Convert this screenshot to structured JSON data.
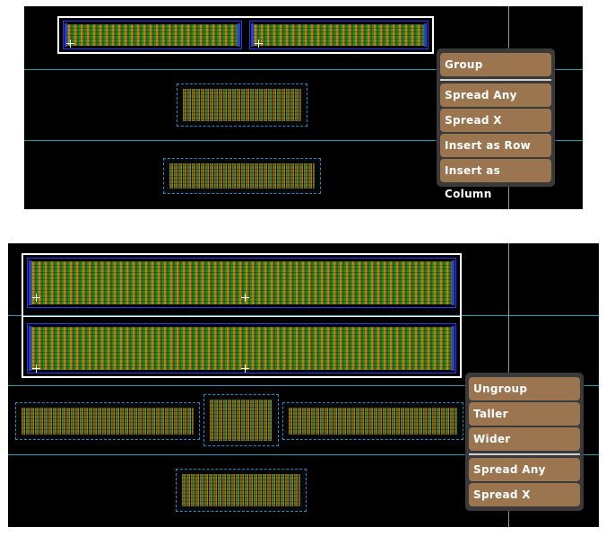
{
  "menus": {
    "top": {
      "items": [
        {
          "label": "Group"
        },
        {
          "label": "Spread Any"
        },
        {
          "label": "Spread X"
        },
        {
          "label": "Insert as Row"
        },
        {
          "label": "Insert as Column"
        }
      ]
    },
    "bottom": {
      "items": [
        {
          "label": "Ungroup"
        },
        {
          "label": "Taller"
        },
        {
          "label": "Wider"
        },
        {
          "label": "Spread Any"
        },
        {
          "label": "Spread X"
        }
      ]
    }
  },
  "colors": {
    "canvas_bg": "#000000",
    "row_guide": "#1f9fb8",
    "menu_item": "#9a7550",
    "selection": "#ffffff"
  }
}
